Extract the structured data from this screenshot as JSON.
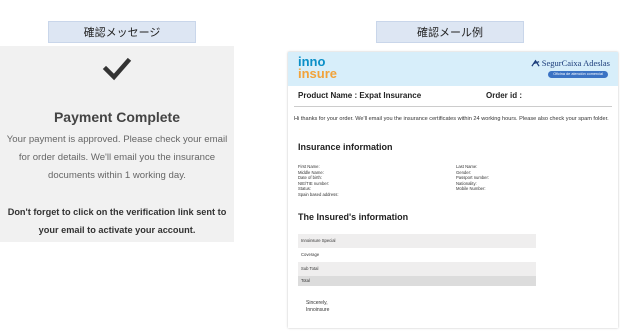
{
  "labels": {
    "message_tag": "確認メッセージ",
    "email_tag": "確認メール例"
  },
  "confirmation": {
    "icon": "checkmark-icon",
    "title": "Payment Complete",
    "body": "Your payment is approved. Please check your email for order details. We'll email you the insurance documents within 1 working day.",
    "warning": "Don't forget to click on the verification link sent to your email to activate your account."
  },
  "email": {
    "logo_line1": "inno",
    "logo_line2": "insure",
    "brand": "SegurCaixa Adeslas",
    "brand_subtitle": "Oficina de atención comercial",
    "product_name": "Product Name : Expat Insurance",
    "order_id": "Order id :",
    "message": "Hi            thanks for your order. We'll email you the insurance certificates within 24 working hours. Please also check your spam folder.",
    "insurance_heading": "Insurance information",
    "fields_left": [
      "First Name:",
      "Middle Name:",
      "Date of birth:",
      "NIE/TIE number:",
      "Status:",
      "Spain based address:"
    ],
    "fields_right": [
      "Last Name:",
      "Gender:",
      "Passport number:",
      "Nationality:",
      "Mobile Number:"
    ],
    "insured_heading": "The Insured's information",
    "table_rows": [
      "Innoinsure Special",
      "Coverage",
      "Sub Total",
      "Total"
    ],
    "signoff_line1": "Sincerely,",
    "signoff_line2": "Innoinsure"
  },
  "colors": {
    "tag_background": "#dde6f3",
    "card_background": "#f1f1f1",
    "email_header": "#d7eefa",
    "logo_blue": "#0a8fc7",
    "logo_orange": "#f2a33a",
    "brand_navy": "#1b3c7a"
  }
}
